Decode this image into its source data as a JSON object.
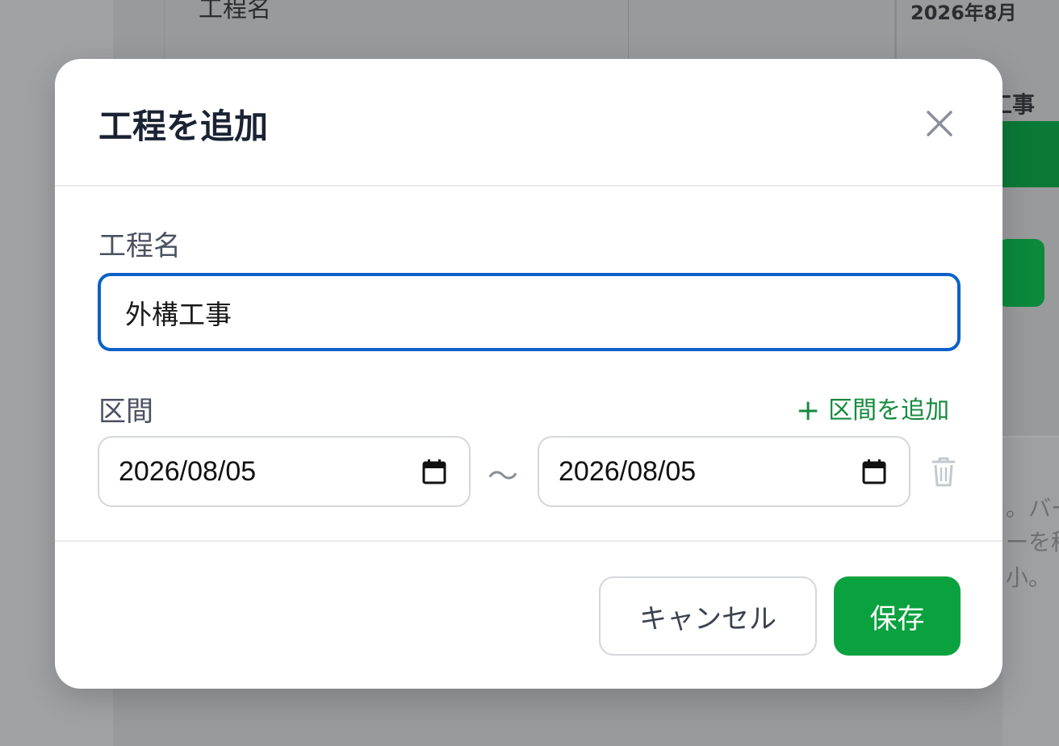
{
  "background": {
    "table_header_name": "工程名",
    "table_header_month": "2026年8月",
    "task_label_partial": "工事",
    "hint_lines": [
      "。バー",
      "ーを移",
      "小。"
    ]
  },
  "modal": {
    "title": "工程を追加",
    "close_icon": "close-icon",
    "name_label": "工程名",
    "name_value": "外構工事",
    "range_label": "区間",
    "add_range_label": "区間を追加",
    "range_separator": "〜",
    "ranges": [
      {
        "start": "2026/08/05",
        "end": "2026/08/05"
      }
    ],
    "cancel_label": "キャンセル",
    "save_label": "保存"
  },
  "colors": {
    "focus_border": "#0a62c9",
    "save_button": "#0aa13f",
    "add_range_text": "#168a3e",
    "title_text": "#1a2233"
  }
}
